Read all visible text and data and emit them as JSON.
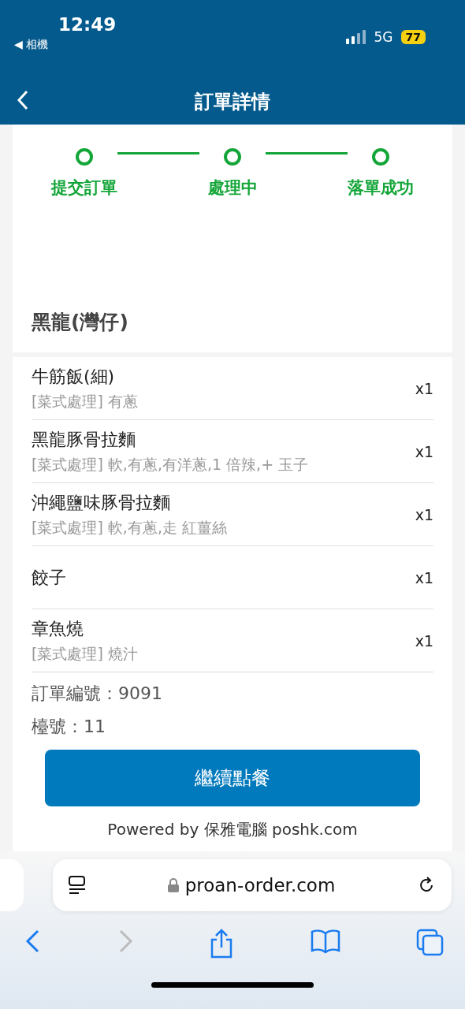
{
  "status_bar": {
    "time": "12:49",
    "back_app": "◀ 相機",
    "network": "5G",
    "battery": "77"
  },
  "header": {
    "title": "訂單詳情"
  },
  "steps": [
    {
      "label": "提交訂單",
      "done": true
    },
    {
      "label": "處理中",
      "done": true
    },
    {
      "label": "落單成功",
      "done": true
    }
  ],
  "shop": {
    "name": "黑龍(灣仔)"
  },
  "items": [
    {
      "name": "牛筋飯(細)",
      "note": "[菜式處理] 有蔥",
      "qty": "x1"
    },
    {
      "name": "黑龍豚骨拉麵",
      "note": "[菜式處理] 軟,有蔥,有洋蔥,1 倍辣,+ 玉子",
      "qty": "x1"
    },
    {
      "name": "沖繩鹽味豚骨拉麵",
      "note": "[菜式處理] 軟,有蔥,走 紅薑絲",
      "qty": "x1"
    },
    {
      "name": "餃子",
      "qty": "x1"
    },
    {
      "name": "章魚燒",
      "note": "[菜式處理] 燒汁",
      "qty": "x1"
    }
  ],
  "order_info": [
    "訂單編號：9091",
    "檯號：11"
  ],
  "continue_button": "繼續點餐",
  "footer": "Powered by 保雅電腦 poshk.com",
  "browser": {
    "url": "proan-order.com"
  }
}
